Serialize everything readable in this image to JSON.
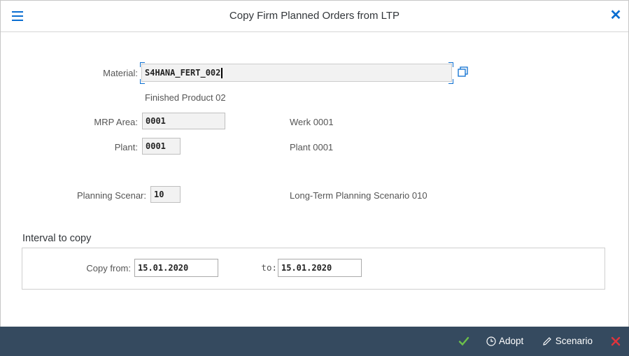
{
  "dialog": {
    "title": "Copy Firm Planned Orders from LTP"
  },
  "icons": {
    "menu": "hamburger-icon",
    "close": "close-icon",
    "value_help": "value-help-icon",
    "check": "checkmark-icon",
    "adopt": "clock-icon",
    "scenario": "pencil-icon",
    "cancel": "cancel-icon"
  },
  "colors": {
    "accent": "#0a6ed1",
    "footer_bg": "#354a5f",
    "check": "#5cb85c",
    "cancel": "#e0343c"
  },
  "form": {
    "material": {
      "label": "Material:",
      "value": "S4HANA_FERT_002",
      "description": "Finished Product 02"
    },
    "mrp_area": {
      "label": "MRP Area:",
      "value": "0001",
      "description": "Werk 0001"
    },
    "plant": {
      "label": "Plant:",
      "value": "0001",
      "description": "Plant 0001"
    },
    "planning_scenario": {
      "label": "Planning Scenar:",
      "value": "10",
      "description": "Long-Term Planning Scenario 010"
    }
  },
  "interval": {
    "title": "Interval to copy",
    "copy_from_label": "Copy from:",
    "copy_from_value": "15.01.2020",
    "to_label": "to:",
    "to_value": "15.01.2020"
  },
  "footer": {
    "adopt_label": "Adopt",
    "scenario_label": "Scenario"
  }
}
